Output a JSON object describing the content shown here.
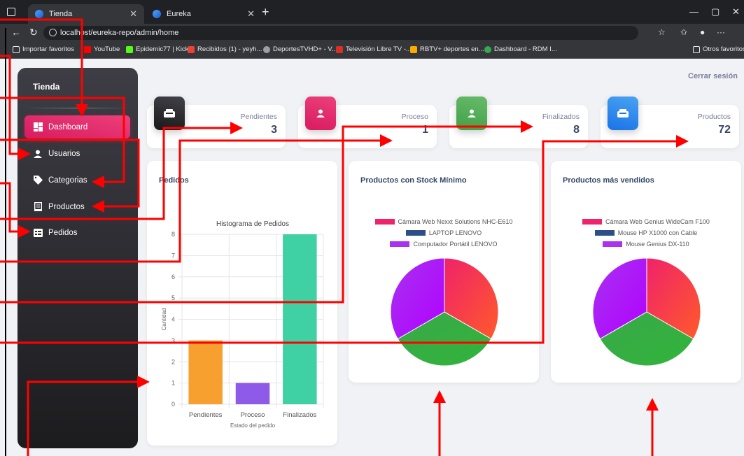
{
  "browser": {
    "tabs": [
      {
        "title": "Tienda",
        "active": true
      },
      {
        "title": "Eureka",
        "active": false
      }
    ],
    "url": "localhost/eureka-repo/admin/home",
    "bookmarks": [
      "Importar favoritos",
      "YouTube",
      "Epidemic77 | Kick",
      "Recibidos (1) - yeyh...",
      "DeportesTVHD+ - V...",
      "Televisión Libre TV -...",
      "RBTV+ deportes en...",
      "Dashboard - RDM I...",
      "Otros favoritos"
    ]
  },
  "sidebar": {
    "brand": "Tienda",
    "items": [
      {
        "label": "Dashboard",
        "icon": "dashboard-icon",
        "active": true
      },
      {
        "label": "Usuarios",
        "icon": "user-icon",
        "active": false
      },
      {
        "label": "Categorias",
        "icon": "tag-icon",
        "active": false
      },
      {
        "label": "Productos",
        "icon": "product-icon",
        "active": false
      },
      {
        "label": "Pedidos",
        "icon": "orders-icon",
        "active": false
      }
    ]
  },
  "header": {
    "logout": "Cerrar sesión"
  },
  "stats": [
    {
      "label": "Pendientes",
      "value": "3",
      "color": "#2b2b2e"
    },
    {
      "label": "Proceso",
      "value": "1",
      "color": "#e91e63"
    },
    {
      "label": "Finalizados",
      "value": "8",
      "color": "#4caf50"
    },
    {
      "label": "Productos",
      "value": "72",
      "color": "#1e88e5"
    }
  ],
  "panels": {
    "pedidos_title": "Pedidos",
    "stock_title": "Productos con Stock Mínimo",
    "vendidos_title": "Productos más vendidos"
  },
  "chart_data": [
    {
      "type": "bar",
      "title": "Histograma de Pedidos",
      "xlabel": "Estado del pedido",
      "ylabel": "Cantidad",
      "categories": [
        "Pendientes",
        "Proceso",
        "Finalizados"
      ],
      "values": [
        3,
        1,
        8
      ],
      "ylim": [
        0,
        8
      ],
      "colors": [
        "#f7a02f",
        "#8e5ae8",
        "#3fd0a3"
      ],
      "grid": true
    },
    {
      "type": "pie",
      "labels": [
        "Cámara Web Nexxt Solutions NHC-E610",
        "LAPTOP LENOVO",
        "Computador Portátil LENOVO"
      ],
      "values": [
        1,
        1,
        1
      ],
      "colors": [
        "#f0226a",
        "#2c4f87",
        "#a832f0"
      ]
    },
    {
      "type": "pie",
      "labels": [
        "Cámara Web Genius WideCam F100",
        "Mouse HP X1000 con Cable",
        "Mouse Genius DX-110"
      ],
      "values": [
        1,
        1,
        1
      ],
      "colors": [
        "#f0226a",
        "#2c4f87",
        "#a832f0"
      ]
    }
  ]
}
